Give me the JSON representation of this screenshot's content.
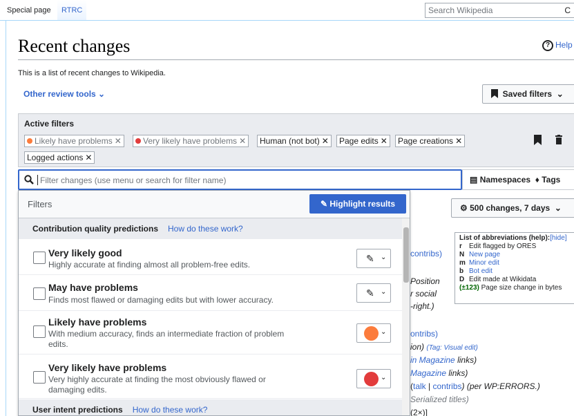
{
  "tabs": {
    "special_page": "Special page",
    "rtrc": "RTRC"
  },
  "search": {
    "placeholder": "Search Wikipedia",
    "icon": "search-icon"
  },
  "page": {
    "title": "Recent changes",
    "help_label": "Help",
    "intro": "This is a list of recent changes to Wikipedia.",
    "review_tools": "Other review tools",
    "saved_filters": "Saved filters"
  },
  "active_filters": {
    "title": "Active filters",
    "chips": [
      {
        "label": "Likely have problems",
        "color": "#fc7c3c"
      },
      {
        "label": "Very likely have problems",
        "color": "#e23c3c"
      },
      {
        "label": "Human (not bot)"
      },
      {
        "label": "Page edits"
      },
      {
        "label": "Page creations"
      },
      {
        "label": "Logged actions"
      }
    ]
  },
  "filter_input": {
    "placeholder": "Filter changes (use menu or search for filter name)"
  },
  "namespaces_label": "Namespaces",
  "tags_label": "Tags",
  "panel": {
    "title": "Filters",
    "highlight_button": "Highlight results",
    "groups": [
      {
        "title": "Contribution quality predictions",
        "link": "How do these work?"
      },
      {
        "title": "User intent predictions",
        "link": "How do these work?"
      }
    ],
    "items": [
      {
        "name": "Very likely good",
        "desc": "Highly accurate at finding almost all problem-free edits."
      },
      {
        "name": "May have problems",
        "desc": "Finds most flawed or damaging edits but with lower accuracy."
      },
      {
        "name": "Likely have problems",
        "desc": "With medium accuracy, finds an intermediate fraction of problem edits.",
        "color": "#fc7c3c"
      },
      {
        "name": "Very likely have problems",
        "desc": "Very highly accurate at finding the most obviously flawed or damaging edits.",
        "color": "#e23c3c"
      }
    ]
  },
  "changes_button": "500 changes, 7 days",
  "legend": {
    "title": "List of abbreviations (help):",
    "hide": "[hide]",
    "rows": [
      {
        "key": "r",
        "text": "Edit flagged by ORES"
      },
      {
        "key": "N",
        "text": "New page"
      },
      {
        "key": "m",
        "text": "Minor edit"
      },
      {
        "key": "b",
        "text": "Bot edit"
      },
      {
        "key": "D",
        "text": "Edit made at Wikidata"
      },
      {
        "key": "(±123)",
        "text": "Page size change in bytes"
      }
    ]
  },
  "background_lines": {
    "l1": "contribs)",
    "l2": "Position",
    "l3": "r social",
    "l4": "-right.)",
    "l5": "ontribs)",
    "l6": "ion)",
    "l6tag": "(Tag: Visual edit)",
    "l7a": "in Magazine",
    "l7b": "links)",
    "l8a": "Magazine",
    "l8b": "links)",
    "l9a": "(",
    "l9talk": "talk",
    "l9sep": " | ",
    "l9contribs": "contribs",
    "l9b": ") (per WP:ERRORS.)",
    "l10": "Serialized titles)",
    "l11": "(2×)]"
  }
}
